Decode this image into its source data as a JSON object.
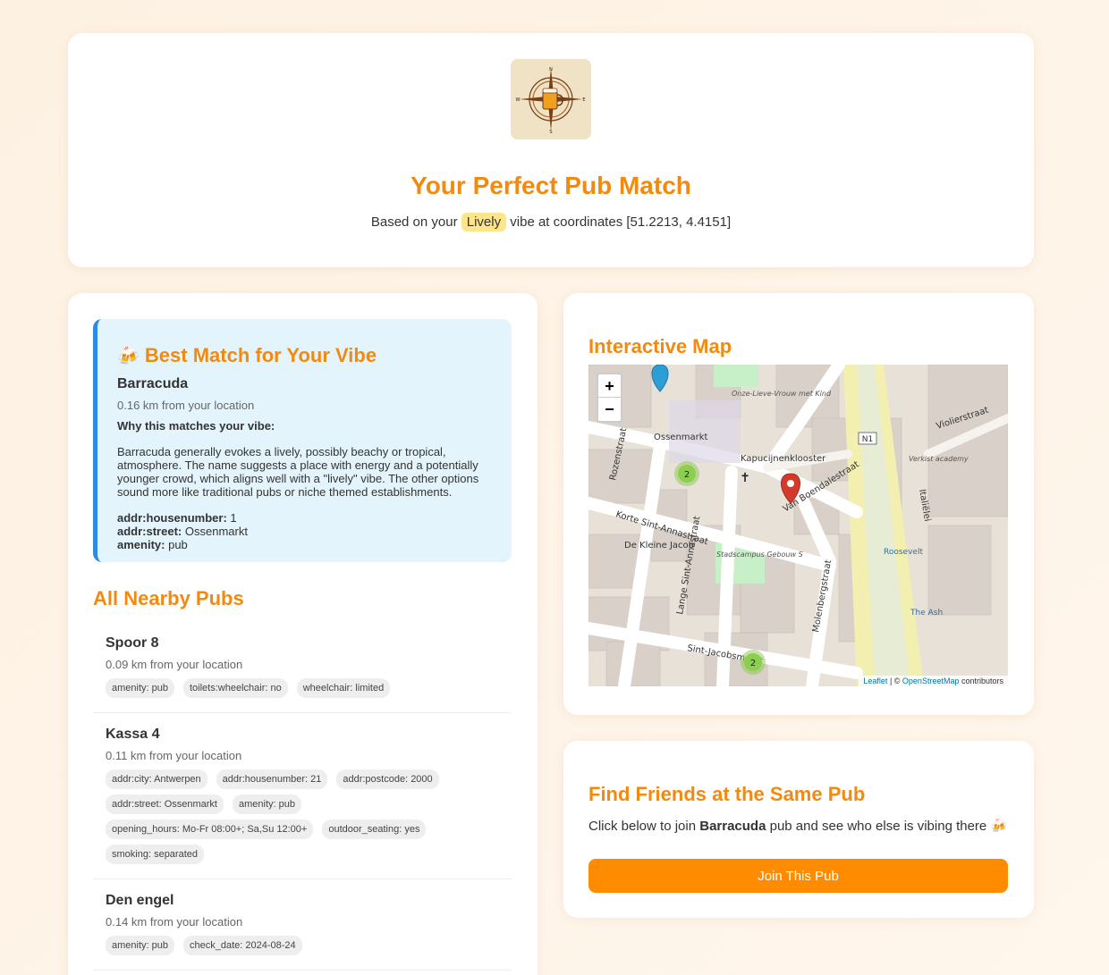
{
  "header": {
    "title": "Your Perfect Pub Match",
    "subtitle_prefix": "Based on your",
    "vibe": "Lively",
    "subtitle_suffix": "vibe at coordinates [51.2213, 4.4151]"
  },
  "best_match": {
    "heading": "Best Match for Your Vibe",
    "icon": "beer-mugs-icon",
    "name": "Barracuda",
    "distance": "0.16 km from your location",
    "why_label": "Why this matches your vibe:",
    "why_text": "Barracuda generally evokes a lively, possibly beachy or tropical, atmosphere. The name suggests a place with energy and a potentially younger crowd, which aligns well with a \"lively\" vibe. The other options sound more like traditional pubs or niche themed establishments.",
    "tags": [
      {
        "key": "addr:housenumber:",
        "value": "1"
      },
      {
        "key": "addr:street:",
        "value": "Ossenmarkt"
      },
      {
        "key": "amenity:",
        "value": "pub"
      }
    ]
  },
  "nearby": {
    "heading": "All Nearby Pubs",
    "pubs": [
      {
        "name": "Spoor 8",
        "distance": "0.09 km from your location",
        "tags": [
          "amenity: pub",
          "toilets:wheelchair: no",
          "wheelchair: limited"
        ]
      },
      {
        "name": "Kassa 4",
        "distance": "0.11 km from your location",
        "tags": [
          "addr:city: Antwerpen",
          "addr:housenumber: 21",
          "addr:postcode: 2000",
          "addr:street: Ossenmarkt",
          "amenity: pub",
          "opening_hours: Mo-Fr 08:00+; Sa,Su 12:00+",
          "outdoor_seating: yes",
          "smoking: separated"
        ]
      },
      {
        "name": "Den engel",
        "distance": "0.14 km from your location",
        "tags": [
          "amenity: pub",
          "check_date: 2024-08-24"
        ]
      }
    ]
  },
  "map": {
    "heading": "Interactive Map",
    "zoom_in": "+",
    "zoom_out": "−",
    "attribution_leaflet": "Leaflet",
    "attribution_sep": " | © ",
    "attribution_osm": "OpenStreetMap",
    "attribution_suffix": " contributors",
    "cluster_label_1": "2",
    "cluster_label_2": "2",
    "labels": {
      "ossenmarkt": "Ossenmarkt",
      "kapucijnenklooster": "Kapucijnenklooster",
      "korte_sint_annastraat": "Korte Sint-Annastraat",
      "lange_sint_annastraat": "Lange Sint-Annastraat",
      "van_boendalestraat": "Van Boendalestraat",
      "violierstraat": "Violierstraat",
      "italielei": "Italiëlei",
      "n1": "N1",
      "de_kleine_jacob": "De Kleine Jacob",
      "stadscampus": "Stadscampus Gebouw S",
      "onze_lieve_vrouw": "Onze-Lieve-Vrouw met Kind",
      "molenbergstraat": "Molenbergstraat",
      "sint_jacobsmarkt": "Sint-Jacobsmarkt",
      "roosevelt": "Roosevelt",
      "the_ash": "The Ash",
      "verkist_academy": "Verkist academy",
      "rozenstraat": "Rozenstraat"
    }
  },
  "friends": {
    "heading": "Find Friends at the Same Pub",
    "text_prefix": "Click below to join",
    "pub_name": "Barracuda",
    "text_suffix": "pub and see who else is vibing there",
    "icon": "beer-mugs-icon",
    "button": "Join This Pub"
  },
  "colors": {
    "accent": "#f38a10",
    "button": "#ff8c00",
    "best_match_bg": "#e3f4fc",
    "best_match_border": "#2b8ce0",
    "vibe_badge": "#fde68a"
  }
}
